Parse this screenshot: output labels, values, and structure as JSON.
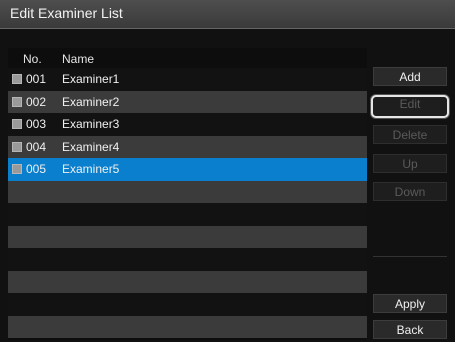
{
  "window": {
    "title": "Edit Examiner List"
  },
  "list": {
    "headers": {
      "no": "No.",
      "name": "Name"
    },
    "selected_index": 4,
    "rows": [
      {
        "no": "001",
        "name": "Examiner1"
      },
      {
        "no": "002",
        "name": "Examiner2"
      },
      {
        "no": "003",
        "name": "Examiner3"
      },
      {
        "no": "004",
        "name": "Examiner4"
      },
      {
        "no": "005",
        "name": "Examiner5"
      },
      {
        "no": "",
        "name": ""
      },
      {
        "no": "",
        "name": ""
      },
      {
        "no": "",
        "name": ""
      },
      {
        "no": "",
        "name": ""
      },
      {
        "no": "",
        "name": ""
      },
      {
        "no": "",
        "name": ""
      },
      {
        "no": "",
        "name": ""
      }
    ]
  },
  "sidebar": {
    "add_label": "Add",
    "edit_label": "Edit",
    "delete_label": "Delete",
    "up_label": "Up",
    "down_label": "Down",
    "apply_label": "Apply",
    "back_label": "Back"
  },
  "colors": {
    "selection": "#0a7fce",
    "title_bar": "#454545",
    "background": "#111111"
  }
}
